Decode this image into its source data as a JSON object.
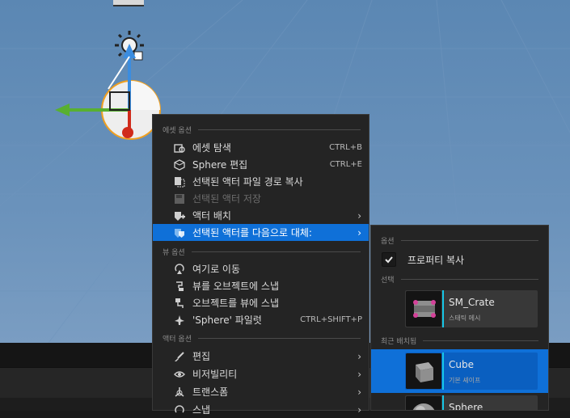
{
  "context_menu": {
    "asset_options_header": "에셋 옵션",
    "items_asset": [
      {
        "label": "에셋 탐색",
        "shortcut": "CTRL+B",
        "icon": "browse-icon"
      },
      {
        "label": "Sphere 편집",
        "shortcut": "CTRL+E",
        "icon": "edit-asset-icon"
      },
      {
        "label": "선택된 액터 파일 경로 복사",
        "shortcut": "",
        "icon": "copy-path-icon"
      },
      {
        "label": "선택된 액터 저장",
        "shortcut": "",
        "icon": "save-icon",
        "disabled": true
      },
      {
        "label": "액터 배치",
        "shortcut": "",
        "icon": "place-actor-icon",
        "submenu": true
      },
      {
        "label": "선택된 액터를 다음으로 대체:",
        "shortcut": "",
        "icon": "replace-actor-icon",
        "submenu": true,
        "highlighted": true
      }
    ],
    "view_options_header": "뷰 옵션",
    "items_view": [
      {
        "label": "여기로 이동",
        "shortcut": "",
        "icon": "go-here-icon"
      },
      {
        "label": "뷰를 오브젝트에 스냅",
        "shortcut": "",
        "icon": "snap-view-icon"
      },
      {
        "label": "오브젝트를 뷰에 스냅",
        "shortcut": "",
        "icon": "snap-object-icon"
      },
      {
        "label": "'Sphere' 파일럿",
        "shortcut": "CTRL+SHIFT+P",
        "icon": "pilot-icon"
      }
    ],
    "actor_options_header": "액터 옵션",
    "items_actor": [
      {
        "label": "편집",
        "icon": "brush-icon",
        "submenu": true
      },
      {
        "label": "비저빌리티",
        "icon": "eye-icon",
        "submenu": true
      },
      {
        "label": "트랜스폼",
        "icon": "transform-icon",
        "submenu": true
      },
      {
        "label": "스냅",
        "icon": "snap-icon",
        "submenu": true
      }
    ]
  },
  "submenu": {
    "options_header": "옵션",
    "copy_properties_label": "프로퍼티 복사",
    "copy_properties_checked": true,
    "selection_header": "선택",
    "selected_asset": {
      "name": "SM_Crate",
      "type": "스태틱 메시"
    },
    "recent_header": "최근 배치됨",
    "recent_assets": [
      {
        "name": "Cube",
        "type": "기본 셰이프",
        "selected": true
      },
      {
        "name": "Sphere",
        "type": ""
      }
    ]
  },
  "colors": {
    "highlight": "#0f70d8",
    "asset_accent": "#16c6e6",
    "menu_bg": "#242424"
  }
}
